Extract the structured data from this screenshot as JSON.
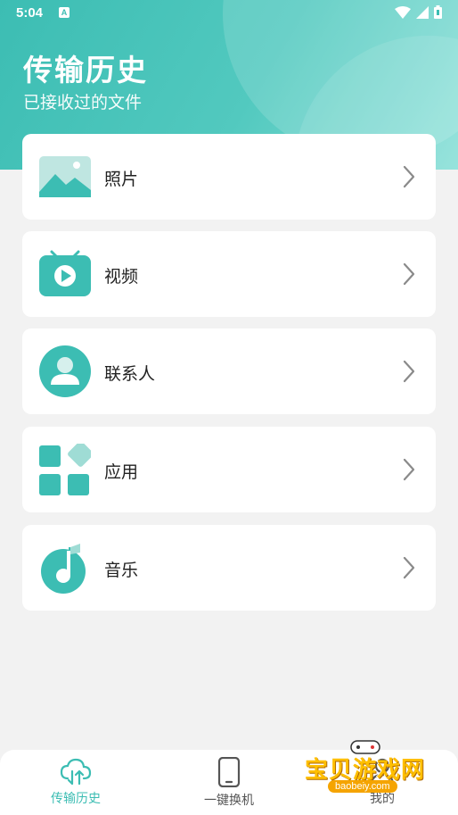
{
  "status_bar": {
    "time": "5:04",
    "notification_badge": "A"
  },
  "header": {
    "title": "传输历史",
    "subtitle": "已接收过的文件"
  },
  "items": [
    {
      "label": "照片",
      "icon": "photo-icon"
    },
    {
      "label": "视频",
      "icon": "video-icon"
    },
    {
      "label": "联系人",
      "icon": "contact-icon"
    },
    {
      "label": "应用",
      "icon": "apps-icon"
    },
    {
      "label": "音乐",
      "icon": "music-icon"
    }
  ],
  "nav": {
    "items": [
      {
        "label": "传输历史",
        "icon": "cloud-transfer-icon",
        "active": true
      },
      {
        "label": "一键换机",
        "icon": "phone-icon",
        "active": false
      },
      {
        "label": "我的",
        "icon": "profile-icon",
        "active": false
      }
    ]
  },
  "watermark": {
    "text": "宝贝游戏网",
    "url": "baobeiy.com"
  },
  "colors": {
    "accent": "#3cbdb3",
    "nav_inactive": "#555555",
    "background": "#f2f2f2"
  }
}
